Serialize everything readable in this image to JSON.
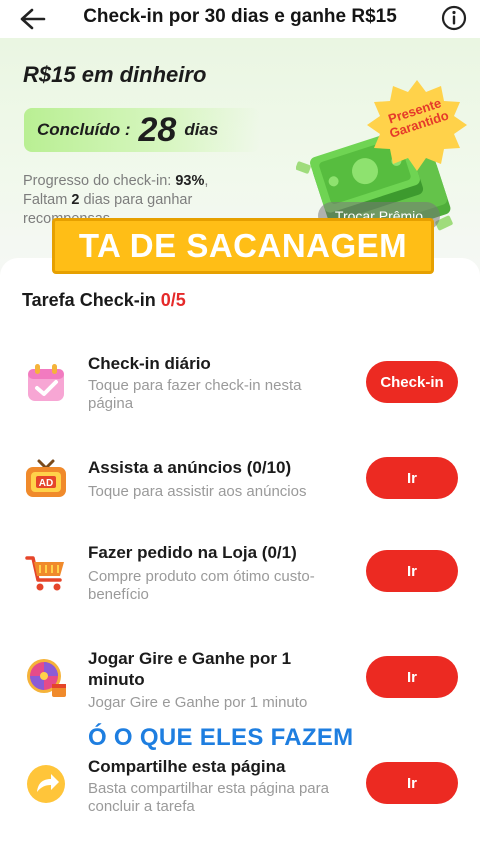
{
  "header": {
    "back_icon": "arrow-left-icon",
    "title": "Check-in por 30 dias e ganhe R$15",
    "info_icon": "info-circle-icon"
  },
  "hero": {
    "reward_title": "R$15 em dinheiro",
    "done_label": "Concluído :",
    "done_days": "28",
    "done_unit": "dias",
    "progress_prefix": "Progresso do check-in: ",
    "progress_value": "93%",
    "progress_suffix": ",",
    "remaining_prefix": "Faltam ",
    "remaining_days": "2",
    "remaining_suffix": " dias para ganhar",
    "remaining_line2": "recompensas",
    "badge_line1": "Presente",
    "badge_line2": "Garantido",
    "redeem_label": "Trocar Prêmio",
    "progress_fraction": 0.93
  },
  "overlay_banner": "TA DE SACANAGEM",
  "overlay_caption": "Ó O QUE ELES FAZEM",
  "tasks": {
    "title": "Tarefa Check-in ",
    "count": "0/5",
    "items": [
      {
        "name": "Check-in diário",
        "desc": "Toque para fazer check-in nesta página",
        "button": "Check-in",
        "icon": "calendar-check-icon"
      },
      {
        "name": "Assista a anúncios  (0/10)",
        "desc": "Toque para assistir aos anúncios",
        "button": "Ir",
        "icon": "tv-ad-icon"
      },
      {
        "name": "Fazer pedido na Loja  (0/1)",
        "desc": "Compre produto com ótimo custo-benefício",
        "button": "Ir",
        "icon": "shopping-cart-icon"
      },
      {
        "name": "Jogar Gire e Ganhe por 1 minuto",
        "desc": "Jogar Gire e Ganhe por 1 minuto",
        "button": "Ir",
        "icon": "prize-wheel-icon"
      },
      {
        "name": "Compartilhe esta página",
        "desc": "Basta compartilhar esta página para concluir a tarefa",
        "button": "Ir",
        "icon": "share-arrow-icon"
      }
    ]
  },
  "colors": {
    "accent_red": "#ec2a22",
    "banner_yellow": "#ffbe16",
    "caption_blue": "#1e7ee0",
    "hero_green": "#eaf6e2"
  }
}
